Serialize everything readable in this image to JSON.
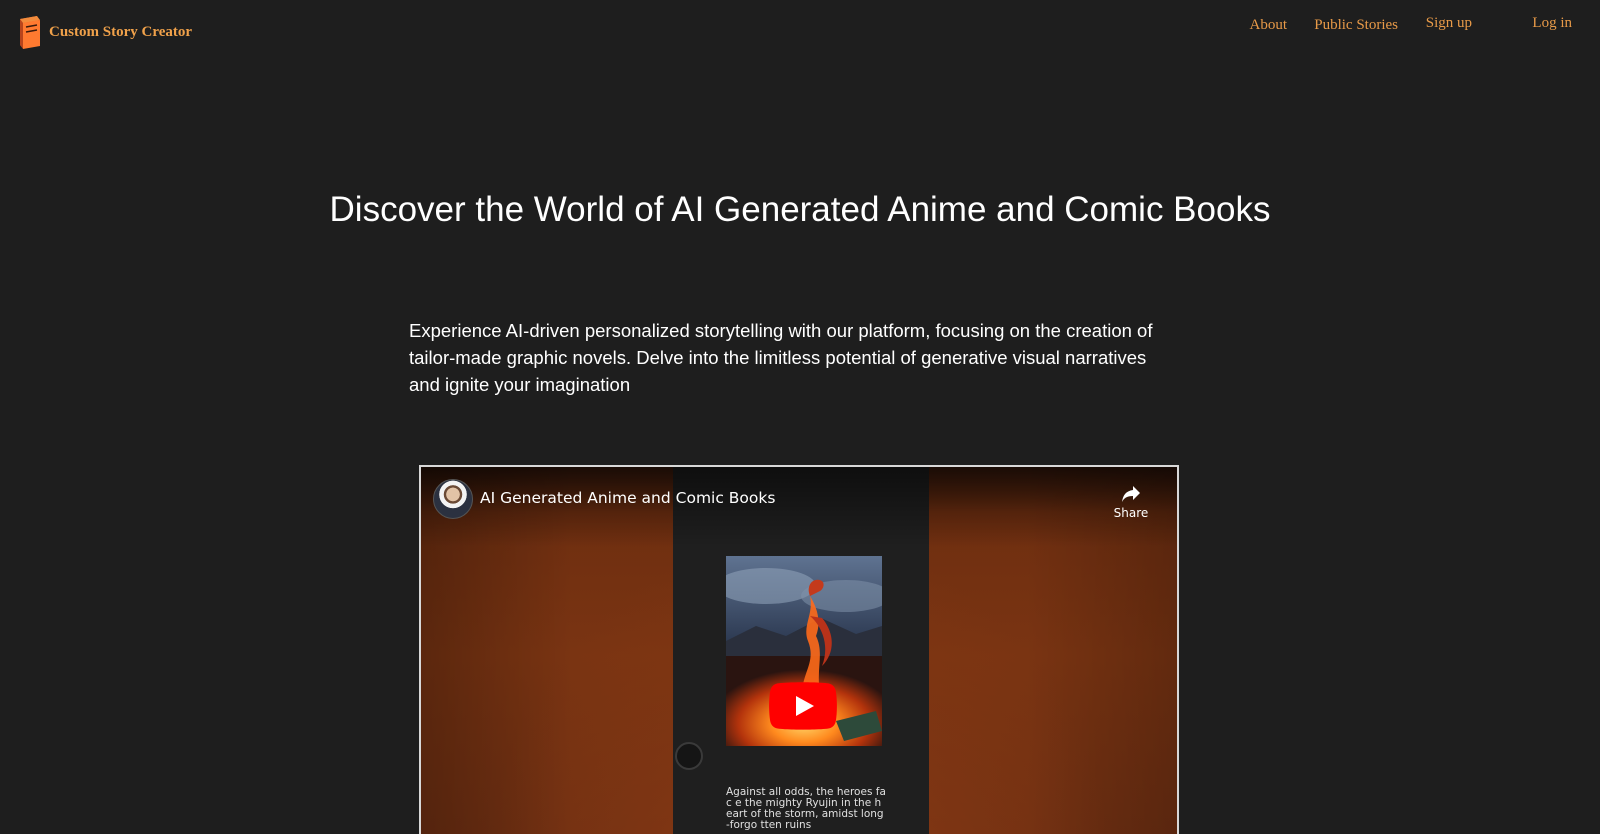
{
  "header": {
    "brand_name": "Custom Story Creator",
    "logo_icon": "book-icon",
    "nav": {
      "about": "About",
      "public_stories": "Public Stories",
      "sign_up": "Sign up",
      "log_in": "Log in"
    },
    "link_color": "#e89a48"
  },
  "hero": {
    "title": "Discover the World of AI Generated Anime and Comic Books",
    "description": "Experience AI-driven personalized storytelling with our platform, focusing on the creation of tailor-made graphic novels. Delve into the limitless potential of generative visual narratives and ignite your imagination"
  },
  "video": {
    "title": "AI Generated Anime and Comic Books",
    "share_label": "Share",
    "share_icon": "share-arrow-icon",
    "play_icon": "play-icon",
    "caption": "Against all odds, the heroes fac e the mighty Ryujin in the heart of the storm, amidst long-forgo tten ruins"
  },
  "colors": {
    "background": "#1e1e1e",
    "accent": "#f0a14a",
    "play_red": "#ff0000"
  }
}
